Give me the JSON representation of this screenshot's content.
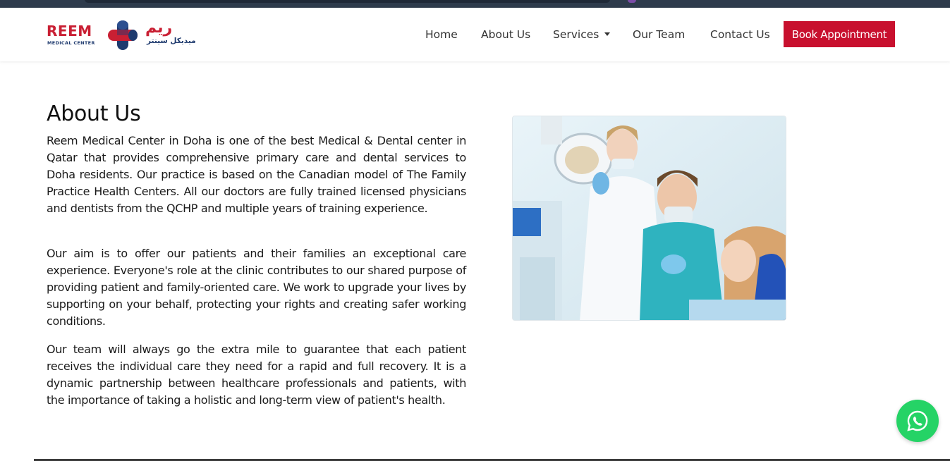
{
  "brand": {
    "name_en": "REEM",
    "subtitle_en": "MEDICAL CENTER",
    "name_ar": "ريم",
    "subtitle_ar": "ميديكل سينتر",
    "color_primary": "#c91f33",
    "color_secondary": "#1e3a6e"
  },
  "nav": {
    "items": [
      {
        "label": "Home"
      },
      {
        "label": "About Us"
      },
      {
        "label": "Services"
      },
      {
        "label": "Our Team"
      },
      {
        "label": "Contact Us"
      }
    ],
    "cta_label": "Book Appointment",
    "cta_color": "#c8102e"
  },
  "main": {
    "title": "About Us",
    "paragraphs": [
      "Reem Medical Center in Doha is one of the best Medical & Dental center in Qatar that provides comprehensive primary care and dental services to Doha residents. Our practice is based on the Canadian model of The Family Practice Health Centers. All our doctors are fully trained licensed physicians and dentists from the QCHP and multiple years of training experience.",
      "Our aim is to offer our patients and their families an exceptional care experience. Everyone's role at the clinic contributes to our shared purpose of providing patient and family-oriented care. We work to upgrade your lives by supporting on your behalf, protecting your rights and creating safer working conditions.",
      "Our team will always go the extra mile to guarantee that each patient receives the individual care they need for a rapid and full recovery. It is a dynamic partnership between healthcare professionals and patients, with the importance of taking a holistic and long-term view of patient's health."
    ],
    "image_icon": "dental-clinic-photo"
  },
  "floating": {
    "icon": "whatsapp-icon",
    "color": "#25d366"
  }
}
